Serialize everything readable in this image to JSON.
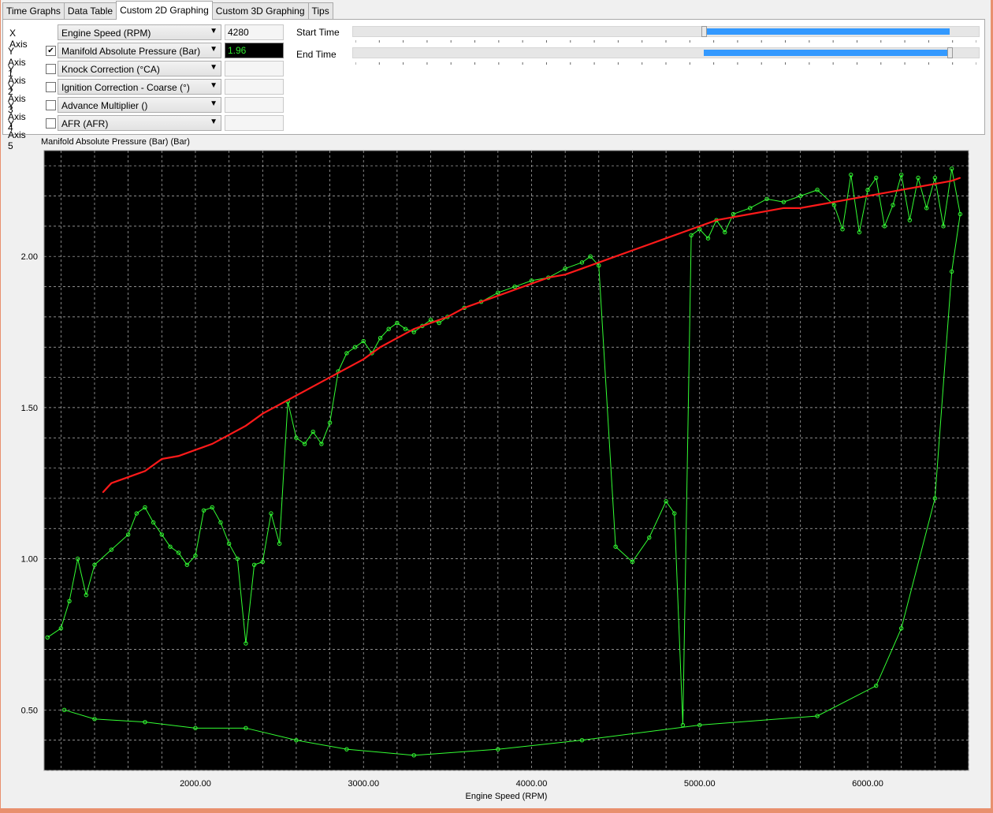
{
  "tabs": [
    {
      "label": "Time Graphs",
      "active": false
    },
    {
      "label": "Data Table",
      "active": false
    },
    {
      "label": "Custom 2D Graphing",
      "active": true
    },
    {
      "label": "Custom 3D Graphing",
      "active": false
    },
    {
      "label": "Tips",
      "active": false
    }
  ],
  "axes": {
    "x": {
      "label": "X Axis",
      "select": "Engine Speed (RPM)",
      "value": "4280"
    },
    "y1": {
      "label": "Y Axis 1",
      "checked": true,
      "select": "Manifold Absolute Pressure (Bar) (B",
      "value": "1.96"
    },
    "y2": {
      "label": "Y Axis 2",
      "checked": false,
      "select": "Knock Correction (°CA)",
      "value": ""
    },
    "y3": {
      "label": "Y Axis 3",
      "checked": false,
      "select": "Ignition Correction - Coarse (°)",
      "value": ""
    },
    "y4": {
      "label": "Y Axis 4",
      "checked": false,
      "select": "Advance Multiplier ()",
      "value": ""
    },
    "y5": {
      "label": "Y Axis 5",
      "checked": false,
      "select": "AFR (AFR)",
      "value": ""
    }
  },
  "time": {
    "start_label": "Start Time",
    "end_label": "End Time",
    "start_range": [
      0.56,
      0.954
    ],
    "end_range": [
      0.56,
      0.954
    ],
    "accent": "#3399ff"
  },
  "chart_data": {
    "type": "scatter",
    "title": "Manifold Absolute Pressure (Bar) (Bar)",
    "xlabel": "Engine Speed (RPM)",
    "ylabel": "",
    "xlim": [
      1100,
      6600
    ],
    "ylim": [
      0.3,
      2.35
    ],
    "xticks": [
      "2000.00",
      "3000.00",
      "4000.00",
      "5000.00",
      "6000.00"
    ],
    "xtick_values": [
      2000,
      3000,
      4000,
      5000,
      6000
    ],
    "yticks": [
      "0.50",
      "1.00",
      "1.50",
      "2.00"
    ],
    "ytick_values": [
      0.5,
      1.0,
      1.5,
      2.0
    ],
    "background": "#000000",
    "grid": true,
    "series": [
      {
        "color": "#ff1a1a",
        "points": [
          [
            1450,
            1.22
          ],
          [
            1500,
            1.25
          ],
          [
            1600,
            1.27
          ],
          [
            1700,
            1.29
          ],
          [
            1800,
            1.33
          ],
          [
            1900,
            1.34
          ],
          [
            2000,
            1.36
          ],
          [
            2100,
            1.38
          ],
          [
            2200,
            1.41
          ],
          [
            2300,
            1.44
          ],
          [
            2400,
            1.48
          ],
          [
            2500,
            1.51
          ],
          [
            2600,
            1.54
          ],
          [
            2700,
            1.57
          ],
          [
            2800,
            1.6
          ],
          [
            2900,
            1.63
          ],
          [
            3000,
            1.66
          ],
          [
            3100,
            1.7
          ],
          [
            3200,
            1.73
          ],
          [
            3300,
            1.76
          ],
          [
            3400,
            1.78
          ],
          [
            3500,
            1.8
          ],
          [
            3600,
            1.83
          ],
          [
            3700,
            1.85
          ],
          [
            3800,
            1.87
          ],
          [
            3900,
            1.89
          ],
          [
            4000,
            1.91
          ],
          [
            4100,
            1.93
          ],
          [
            4200,
            1.94
          ],
          [
            4300,
            1.96
          ],
          [
            4400,
            1.98
          ],
          [
            4500,
            2.0
          ],
          [
            4600,
            2.02
          ],
          [
            4700,
            2.04
          ],
          [
            4800,
            2.06
          ],
          [
            4900,
            2.08
          ],
          [
            5000,
            2.1
          ],
          [
            5100,
            2.12
          ],
          [
            5200,
            2.13
          ],
          [
            5300,
            2.14
          ],
          [
            5400,
            2.15
          ],
          [
            5500,
            2.16
          ],
          [
            5600,
            2.16
          ],
          [
            5700,
            2.17
          ],
          [
            5800,
            2.18
          ],
          [
            5900,
            2.19
          ],
          [
            6000,
            2.2
          ],
          [
            6100,
            2.21
          ],
          [
            6200,
            2.22
          ],
          [
            6300,
            2.23
          ],
          [
            6400,
            2.24
          ],
          [
            6500,
            2.25
          ],
          [
            6550,
            2.26
          ]
        ]
      },
      {
        "color": "#33ff33",
        "points": [
          [
            1120,
            0.74
          ],
          [
            1200,
            0.77
          ],
          [
            1250,
            0.86
          ],
          [
            1300,
            1.0
          ],
          [
            1350,
            0.88
          ],
          [
            1400,
            0.98
          ],
          [
            1500,
            1.03
          ],
          [
            1600,
            1.08
          ],
          [
            1650,
            1.15
          ],
          [
            1700,
            1.17
          ],
          [
            1750,
            1.12
          ],
          [
            1800,
            1.08
          ],
          [
            1850,
            1.04
          ],
          [
            1900,
            1.02
          ],
          [
            1950,
            0.98
          ],
          [
            2000,
            1.01
          ],
          [
            2050,
            1.16
          ],
          [
            2100,
            1.17
          ],
          [
            2150,
            1.12
          ],
          [
            2200,
            1.05
          ],
          [
            2250,
            1.0
          ],
          [
            2300,
            0.72
          ],
          [
            2350,
            0.98
          ],
          [
            2400,
            0.99
          ],
          [
            2450,
            1.15
          ],
          [
            2500,
            1.05
          ],
          [
            2550,
            1.52
          ],
          [
            2600,
            1.4
          ],
          [
            2650,
            1.38
          ],
          [
            2700,
            1.42
          ],
          [
            2750,
            1.38
          ],
          [
            2800,
            1.45
          ],
          [
            2850,
            1.62
          ],
          [
            2900,
            1.68
          ],
          [
            2950,
            1.7
          ],
          [
            3000,
            1.72
          ],
          [
            3050,
            1.68
          ],
          [
            3100,
            1.73
          ],
          [
            3150,
            1.76
          ],
          [
            3200,
            1.78
          ],
          [
            3250,
            1.76
          ],
          [
            3300,
            1.75
          ],
          [
            3350,
            1.77
          ],
          [
            3400,
            1.79
          ],
          [
            3450,
            1.78
          ],
          [
            3500,
            1.8
          ],
          [
            3600,
            1.83
          ],
          [
            3700,
            1.85
          ],
          [
            3800,
            1.88
          ],
          [
            3900,
            1.9
          ],
          [
            4000,
            1.92
          ],
          [
            4100,
            1.93
          ],
          [
            4200,
            1.96
          ],
          [
            4300,
            1.98
          ],
          [
            4350,
            2.0
          ],
          [
            4400,
            1.97
          ],
          [
            4500,
            1.04
          ],
          [
            4600,
            0.99
          ],
          [
            4700,
            1.07
          ],
          [
            4800,
            1.19
          ],
          [
            4850,
            1.15
          ],
          [
            4900,
            0.45
          ],
          [
            4950,
            2.07
          ],
          [
            5000,
            2.09
          ],
          [
            5050,
            2.06
          ],
          [
            5100,
            2.12
          ],
          [
            5150,
            2.08
          ],
          [
            5200,
            2.14
          ],
          [
            5300,
            2.16
          ],
          [
            5400,
            2.19
          ],
          [
            5500,
            2.18
          ],
          [
            5600,
            2.2
          ],
          [
            5700,
            2.22
          ],
          [
            5800,
            2.17
          ],
          [
            5850,
            2.09
          ],
          [
            5900,
            2.27
          ],
          [
            5950,
            2.08
          ],
          [
            6000,
            2.22
          ],
          [
            6050,
            2.26
          ],
          [
            6100,
            2.1
          ],
          [
            6150,
            2.17
          ],
          [
            6200,
            2.27
          ],
          [
            6250,
            2.12
          ],
          [
            6300,
            2.26
          ],
          [
            6350,
            2.16
          ],
          [
            6400,
            2.26
          ],
          [
            6450,
            2.1
          ],
          [
            6500,
            2.29
          ],
          [
            6550,
            2.14
          ],
          [
            6500,
            1.95
          ],
          [
            6400,
            1.2
          ],
          [
            6200,
            0.77
          ],
          [
            6050,
            0.58
          ],
          [
            5700,
            0.48
          ],
          [
            5000,
            0.45
          ],
          [
            4300,
            0.4
          ],
          [
            3800,
            0.37
          ],
          [
            3300,
            0.35
          ],
          [
            2900,
            0.37
          ],
          [
            2600,
            0.4
          ],
          [
            2300,
            0.44
          ],
          [
            2000,
            0.44
          ],
          [
            1700,
            0.46
          ],
          [
            1400,
            0.47
          ],
          [
            1220,
            0.5
          ]
        ]
      }
    ]
  }
}
